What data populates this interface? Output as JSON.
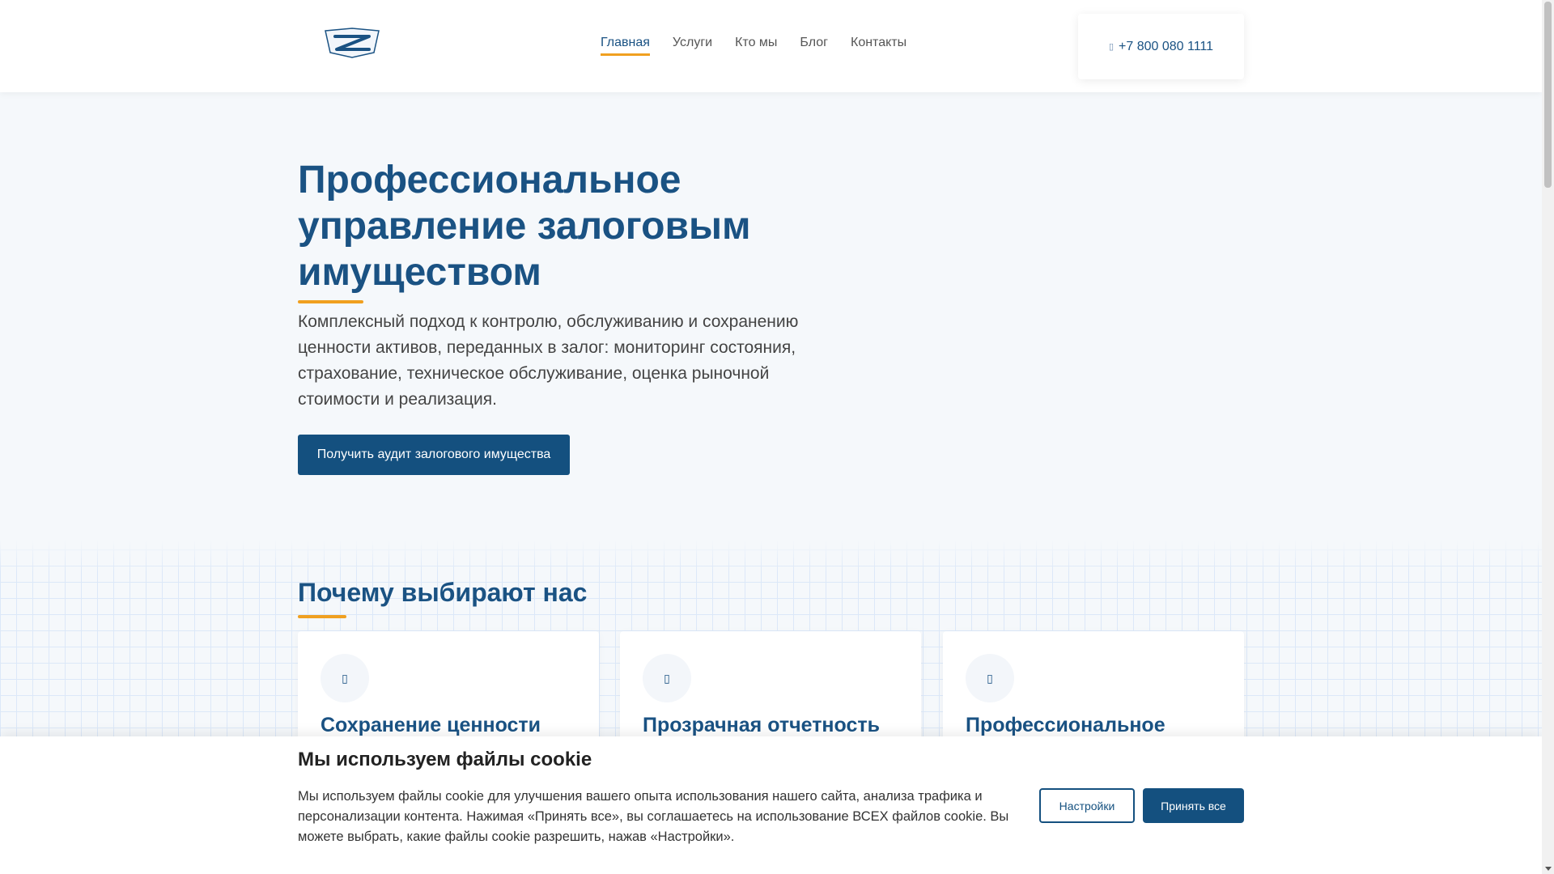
{
  "header": {
    "nav": [
      "Главная",
      "Услуги",
      "Кто мы",
      "Блог",
      "Контакты"
    ],
    "phone": "+7 800 080 1111"
  },
  "hero": {
    "title": "Профессиональное управление залоговым имуществом",
    "text": "Комплексный подход к контролю, обслуживанию и сохранению ценности активов, переданных в залог: мониторинг состояния, страхование, техническое обслуживание, оценка рыночной стоимости и реализация.",
    "cta": "Получить аудит залогового имущества"
  },
  "why": {
    "title": "Почему выбирают нас",
    "cards": [
      "Сохранение ценности",
      "Прозрачная отчетность",
      "Профессиональное"
    ]
  },
  "cookie": {
    "title": "Мы используем файлы cookie",
    "text": "Мы используем файлы cookie для улучшения вашего опыта использования нашего сайта, анализа трафика и персонализации контента. Нажимая «Принять все», вы соглашаетесь на использование ВСЕХ файлов cookie. Вы можете выбрать, какие файлы cookie разрешить, нажав «Настройки».",
    "settings": "Настройки",
    "accept": "Принять все"
  },
  "colors": {
    "brand": "#14507f",
    "accent": "#f0a020"
  }
}
